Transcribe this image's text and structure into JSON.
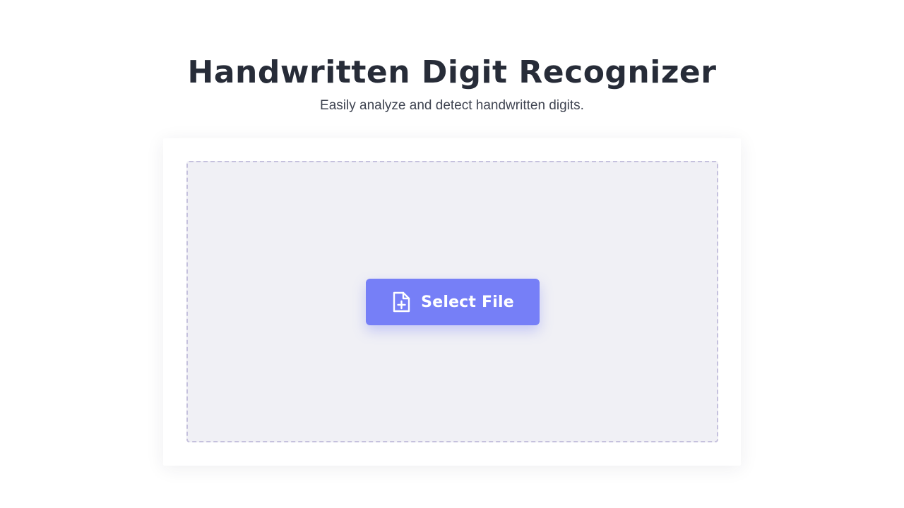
{
  "header": {
    "title": "Handwritten Digit Recognizer",
    "subtitle": "Easily analyze and detect handwritten digits."
  },
  "upload": {
    "button_label": "Select File",
    "button_icon": "file-plus-icon"
  },
  "colors": {
    "accent": "#767ff7",
    "title": "#272c38",
    "dropzone_bg": "#f0f0f5",
    "dropzone_border": "#c5c1dd"
  }
}
